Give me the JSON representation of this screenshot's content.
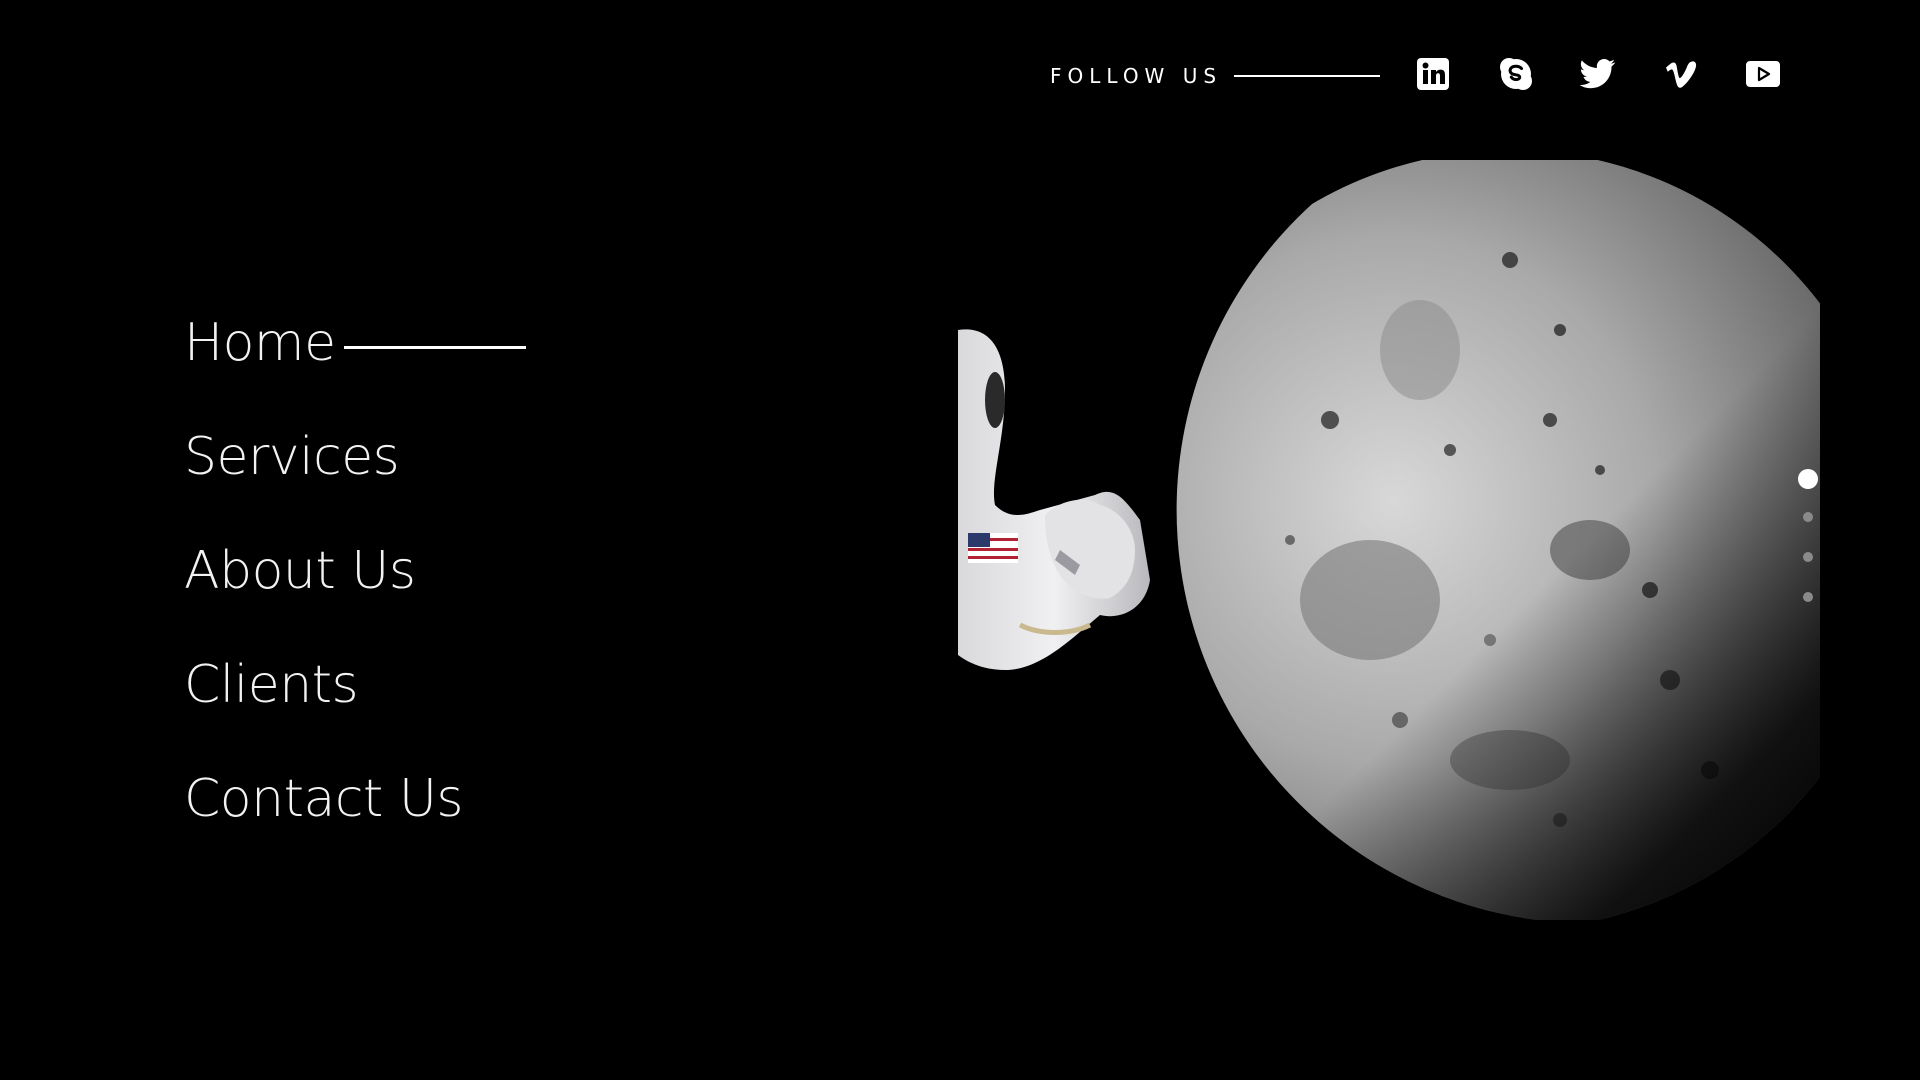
{
  "header": {
    "follow_label": "FOLLOW US",
    "social": [
      {
        "name": "linkedin-icon",
        "label": "LinkedIn"
      },
      {
        "name": "skype-icon",
        "label": "Skype"
      },
      {
        "name": "twitter-icon",
        "label": "Twitter"
      },
      {
        "name": "vimeo-icon",
        "label": "Vimeo"
      },
      {
        "name": "youtube-icon",
        "label": "YouTube"
      }
    ]
  },
  "nav": {
    "items": [
      {
        "label": "Home",
        "active": true
      },
      {
        "label": "Services",
        "active": false
      },
      {
        "label": "About Us",
        "active": false
      },
      {
        "label": "Clients",
        "active": false
      },
      {
        "label": "Contact Us",
        "active": false
      }
    ]
  },
  "pager": {
    "count": 4,
    "active_index": 0
  },
  "colors": {
    "background": "#000000",
    "text": "#f2f2f2",
    "accent": "#ffffff",
    "inactive_dot": "#8a8a8a"
  }
}
